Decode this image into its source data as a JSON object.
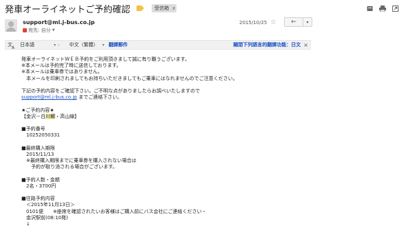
{
  "subject": {
    "title": "発車オーライネットご予約確認",
    "tag_label": "受信箱",
    "tag_close": "x"
  },
  "top_actions": {
    "icons": [
      "archive-icon",
      "print-icon",
      "new-window-icon"
    ]
  },
  "sender": {
    "email": "support@ml.j-bus.co.jp",
    "recipient_label": "宛先: 自分",
    "date": "2015/10/25",
    "reply_glyph": "←",
    "more_glyph": "▾"
  },
  "translate": {
    "from_lang": "日本語",
    "arrow": "›",
    "to_lang": "中文（繁體）",
    "action": "翻譯郵件",
    "setting": "關閉下列語言的翻譯功能：日文",
    "close": "×"
  },
  "body": {
    "l1": "発車オーライネットＷＥＢ予約をご利用頂きまして誠に有り難うございます。",
    "l2": "※本メールは予約完了時に送信しております。",
    "l3": "※本メールは乗車券ではありません。",
    "l4": "　本メールを印刷されましてもお持ちいただきましてもご乗車にはなれませんのでご注意ください。",
    "l5": "下記の予約内容をご確認下さい。ご不明な点がありましたらお調べいたしますので",
    "l6_email": "support@ml.j-bus.co.jp",
    "l6_rest": " までご連絡下さい。",
    "l7": "★ご予約内容★",
    "l8_pre": "【金沢－白",
    "l8_hl": "川郷",
    "l8_post": "・高山線】",
    "l9": "■予約番号",
    "l10": "10252050331",
    "l11": "■最終購入期限",
    "l12": "2015/11/13",
    "l13": "※最終購入期限までに乗車券を購入されない場合は",
    "l14": "　予約が取り消される場合がございます。",
    "l15": "■予約人数・金額",
    "l16": "2名・3700円",
    "l17": "■往路予約内容",
    "l18": "＜2015年11月13日＞",
    "l19": "0101便　　※座席を確認されたいお客様はご購入前にバス会社にご連絡ください・",
    "l20": "金沢駅前(08:10発)",
    "l21": "↓"
  },
  "colors": {
    "link": "#1a51c4",
    "label_tag": "#f4c242",
    "important": "#e04333"
  }
}
